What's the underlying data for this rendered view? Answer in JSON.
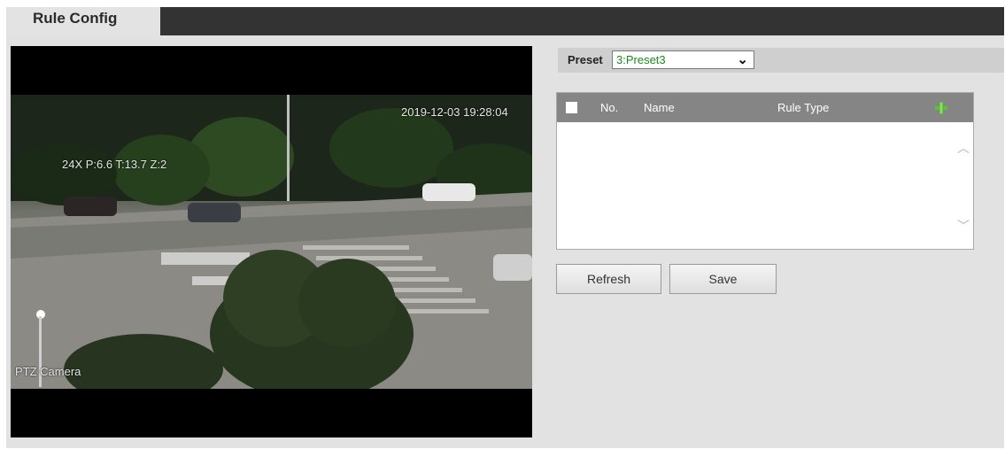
{
  "tab": {
    "title": "Rule Config"
  },
  "video": {
    "timestamp": "2019-12-03 19:28:04",
    "ptz_info": "24X P:6.6 T:13.7 Z:2",
    "camera_name": "PTZ Camera"
  },
  "preset": {
    "label": "Preset",
    "selected": "3:Preset3"
  },
  "rules_table": {
    "columns": {
      "no": "No.",
      "name": "Name",
      "rule_type": "Rule Type"
    },
    "rows": []
  },
  "buttons": {
    "refresh": "Refresh",
    "save": "Save"
  },
  "colors": {
    "header_bar": "#333333",
    "table_header": "#858585",
    "accent_green": "#1b8a1b"
  },
  "icons": {
    "add": "plus-icon",
    "scroll_up": "chevron-up-icon",
    "scroll_down": "chevron-down-icon"
  }
}
